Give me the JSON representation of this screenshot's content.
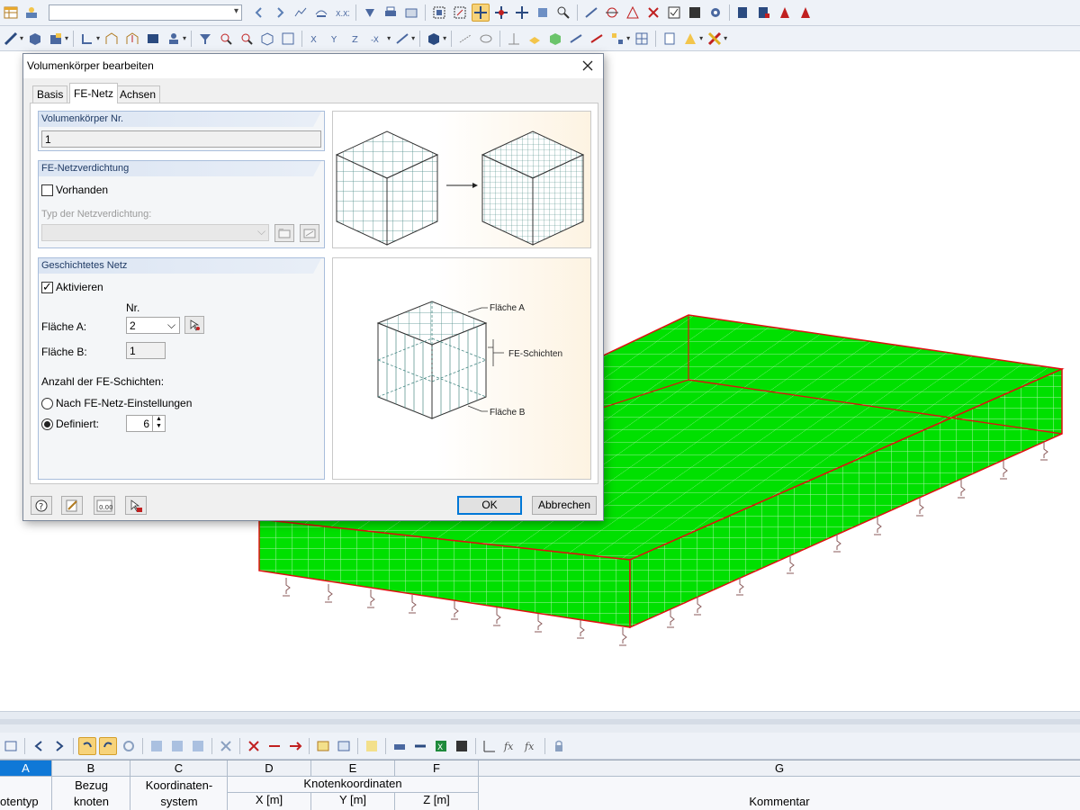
{
  "dialog": {
    "title": "Volumenkörper bearbeiten",
    "tabs": [
      "Basis",
      "FE-Netz",
      "Achsen"
    ],
    "selected_tab": "FE-Netz",
    "solid_group": {
      "header": "Volumenkörper Nr.",
      "value": "1"
    },
    "refinement_group": {
      "header": "FE-Netzverdichtung",
      "present_label": "Vorhanden",
      "present_checked": false,
      "type_label": "Typ der Netzverdichtung:",
      "type_value": ""
    },
    "layered_group": {
      "header": "Geschichtetes Netz",
      "activate_label": "Aktivieren",
      "activate_checked": true,
      "nr_label": "Nr.",
      "surface_a_label": "Fläche A:",
      "surface_a_value": "2",
      "surface_b_label": "Fläche B:",
      "surface_b_value": "1",
      "layer_count_label": "Anzahl der FE-Schichten:",
      "option_settings_label": "Nach FE-Netz-Einstellungen",
      "option_defined_label": "Definiert:",
      "selected_option": "Definiert",
      "defined_value": "6"
    },
    "illustration": {
      "label_surface_a": "Fläche A",
      "label_layers": "FE-Schichten",
      "label_surface_b": "Fläche B"
    },
    "ok_label": "OK",
    "cancel_label": "Abbrechen"
  },
  "toolbar": {
    "combo_value": ""
  },
  "table": {
    "columns": [
      {
        "letter": "A",
        "line1": "",
        "line2": "otentyp"
      },
      {
        "letter": "B",
        "line1": "Bezug",
        "line2": "knoten"
      },
      {
        "letter": "C",
        "line1": "Koordinaten-",
        "line2": "system"
      },
      {
        "letter": "D",
        "line1": "",
        "line2": "X [m]"
      },
      {
        "letter": "E",
        "line1": "",
        "line2": "Y [m]"
      },
      {
        "letter": "F",
        "line1": "",
        "line2": "Z [m]"
      },
      {
        "letter": "G",
        "line1": "",
        "line2": "Kommentar"
      }
    ],
    "group_header": "Knotenkoordinaten"
  },
  "colors": {
    "model_fill": "#00e000",
    "model_edge": "#e01010",
    "accent": "#0f78d7",
    "active_tool": "#f7d37a"
  }
}
